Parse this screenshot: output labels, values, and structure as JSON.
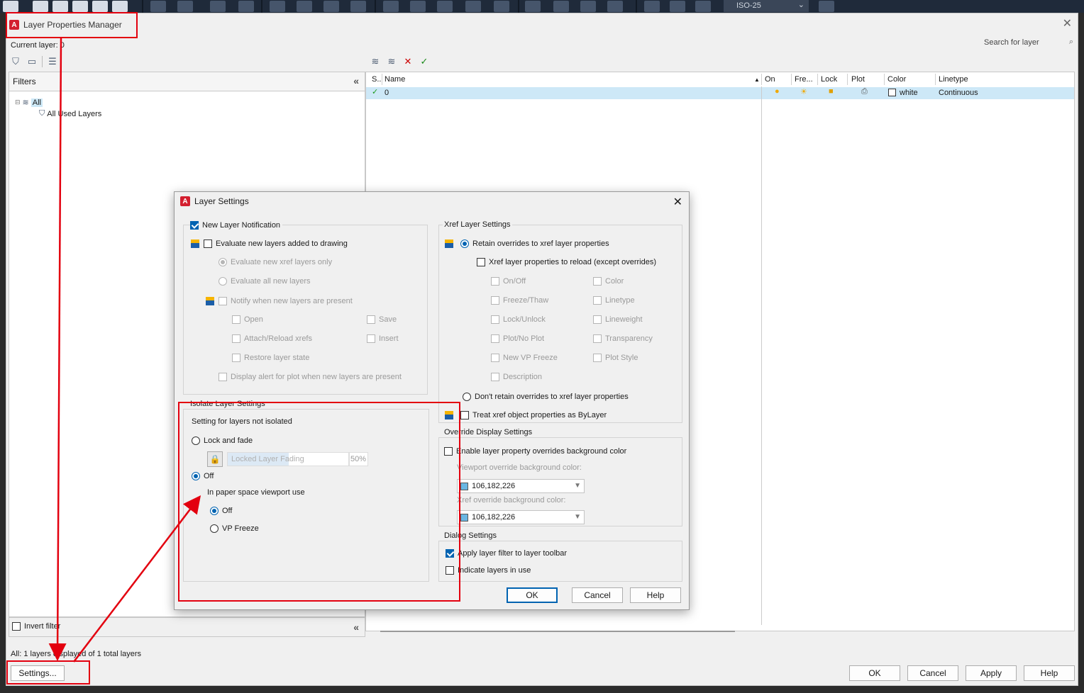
{
  "ribbon": {
    "combo_value": "ISO-25"
  },
  "manager": {
    "title": "Layer Properties Manager",
    "current_layer_label": "Current layer: 0",
    "search_placeholder": "Search for layer",
    "filters_header": "Filters",
    "tree": {
      "all": "All",
      "used": "All Used Layers"
    },
    "invert_filter": "Invert filter",
    "status": "All: 1 layers displayed of 1 total layers",
    "settings_button": "Settings...",
    "buttons": {
      "ok": "OK",
      "cancel": "Cancel",
      "apply": "Apply",
      "help": "Help"
    }
  },
  "grid": {
    "columns": {
      "status": "S..",
      "name": "Name",
      "on": "On",
      "freeze": "Fre...",
      "lock": "Lock",
      "plot": "Plot",
      "color": "Color",
      "linetype": "Linetype"
    },
    "rows": [
      {
        "name": "0",
        "color": "white",
        "linetype": "Continuous"
      }
    ]
  },
  "dialog": {
    "title": "Layer Settings",
    "new_layer": {
      "title": "New Layer Notification",
      "evaluate": "Evaluate new layers added to drawing",
      "xref_only": "Evaluate new xref layers only",
      "all_new": "Evaluate all new layers",
      "notify": "Notify when new layers are present",
      "open": "Open",
      "save": "Save",
      "attach": "Attach/Reload xrefs",
      "insert": "Insert",
      "restore": "Restore layer state",
      "display_alert": "Display alert for plot when new layers are present"
    },
    "isolate": {
      "title": "Isolate Layer Settings",
      "subtitle": "Setting for layers not isolated",
      "lock_fade": "Lock and fade",
      "fading_label": "Locked Layer Fading",
      "fading_value": "50%",
      "off": "Off",
      "paper_space": "In paper space viewport use",
      "ps_off": "Off",
      "vp_freeze": "VP Freeze"
    },
    "xref": {
      "title": "Xref Layer Settings",
      "retain": "Retain overrides to xref layer properties",
      "reload": "Xref layer properties to reload (except overrides)",
      "onoff": "On/Off",
      "color": "Color",
      "freeze": "Freeze/Thaw",
      "linetype": "Linetype",
      "lock": "Lock/Unlock",
      "lineweight": "Lineweight",
      "plot": "Plot/No Plot",
      "transparency": "Transparency",
      "vpfreeze": "New VP Freeze",
      "plotstyle": "Plot Style",
      "description": "Description",
      "dont_retain": "Don't retain overrides to xref layer properties",
      "bylayer": "Treat xref object properties as ByLayer"
    },
    "override": {
      "title": "Override Display Settings",
      "enable": "Enable layer property overrides background color",
      "viewport_label": "Viewport override background color:",
      "viewport_value": "106,182,226",
      "xref_label": "Xref override background color:",
      "xref_value": "106,182,226"
    },
    "dialog_settings": {
      "title": "Dialog Settings",
      "apply_filter": "Apply layer filter to layer toolbar",
      "indicate": "Indicate layers in use"
    },
    "buttons": {
      "ok": "OK",
      "cancel": "Cancel",
      "help": "Help"
    }
  }
}
